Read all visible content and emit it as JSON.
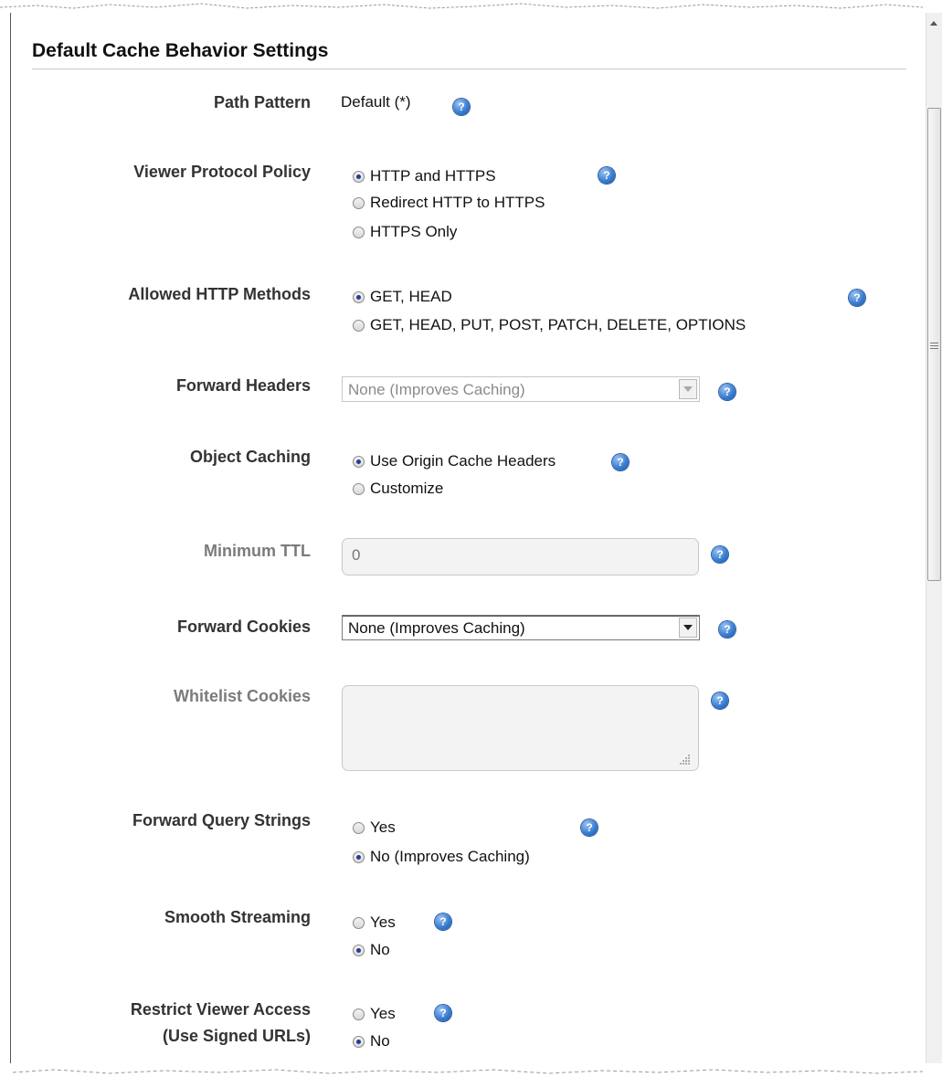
{
  "section": {
    "title": "Default Cache Behavior Settings"
  },
  "path_pattern": {
    "label": "Path Pattern",
    "value": "Default (*)"
  },
  "viewer_protocol_policy": {
    "label": "Viewer Protocol Policy",
    "options": [
      "HTTP and HTTPS",
      "Redirect HTTP to HTTPS",
      "HTTPS Only"
    ],
    "selected": "HTTP and HTTPS"
  },
  "allowed_http_methods": {
    "label": "Allowed HTTP Methods",
    "options": [
      "GET, HEAD",
      "GET, HEAD, PUT, POST, PATCH, DELETE, OPTIONS"
    ],
    "selected": "GET, HEAD"
  },
  "forward_headers": {
    "label": "Forward Headers",
    "value": "None (Improves Caching)"
  },
  "object_caching": {
    "label": "Object Caching",
    "options": [
      "Use Origin Cache Headers",
      "Customize"
    ],
    "selected": "Use Origin Cache Headers"
  },
  "minimum_ttl": {
    "label": "Minimum TTL",
    "value": "0"
  },
  "forward_cookies": {
    "label": "Forward Cookies",
    "value": "None (Improves Caching)"
  },
  "whitelist_cookies": {
    "label": "Whitelist Cookies",
    "value": ""
  },
  "forward_query_strings": {
    "label": "Forward Query Strings",
    "options": [
      "Yes",
      "No (Improves Caching)"
    ],
    "selected": "No (Improves Caching)"
  },
  "smooth_streaming": {
    "label": "Smooth Streaming",
    "options": [
      "Yes",
      "No"
    ],
    "selected": "No"
  },
  "restrict_viewer_access": {
    "label_line1": "Restrict Viewer Access",
    "label_line2": "(Use Signed URLs)",
    "options": [
      "Yes",
      "No"
    ],
    "selected": "No"
  },
  "icons": {
    "help": "help-question-icon",
    "scroll_up": "scroll-up-arrow-icon"
  },
  "colors": {
    "accent": "#3b7fd2",
    "radio_checked": "#1e3f8c",
    "disabled_label": "#7b7b7b"
  }
}
